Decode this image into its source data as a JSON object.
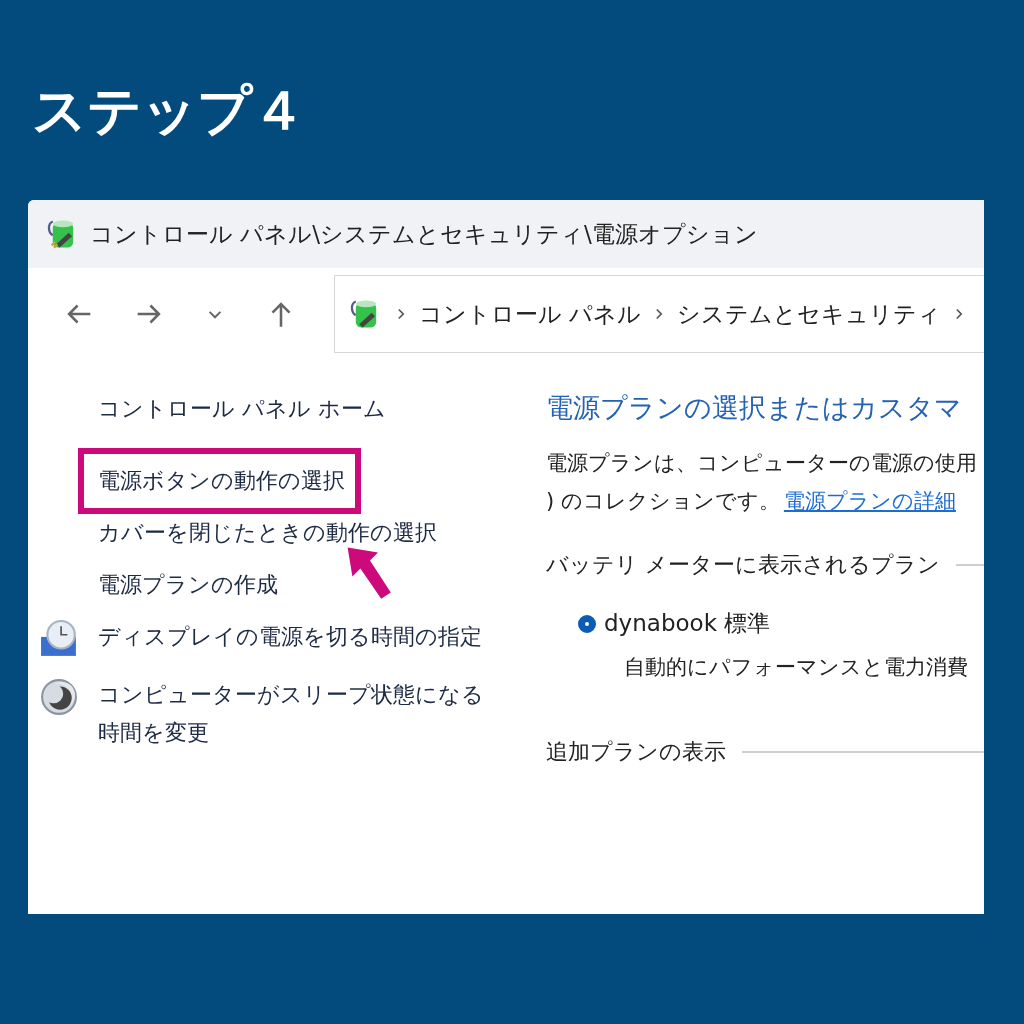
{
  "heading": "ステップ４",
  "window": {
    "title": "コントロール パネル\\システムとセキュリティ\\電源オプション"
  },
  "nav": {
    "breadcrumb": [
      "コントロール パネル",
      "システムとセキュリティ"
    ]
  },
  "sidebar": {
    "items": [
      {
        "label": "コントロール パネル ホーム",
        "kind": "plain",
        "highlighted": false
      },
      {
        "label": "電源ボタンの動作の選択",
        "kind": "plain",
        "highlighted": true
      },
      {
        "label": "カバーを閉じたときの動作の選択",
        "kind": "plain",
        "highlighted": false
      },
      {
        "label": "電源プランの作成",
        "kind": "plain",
        "highlighted": false
      },
      {
        "label": "ディスプレイの電源を切る時間の指定",
        "kind": "display",
        "highlighted": false
      },
      {
        "label": "コンピューターがスリープ状態になる時間を変更",
        "kind": "sleep",
        "highlighted": false
      }
    ]
  },
  "content": {
    "title": "電源プランの選択またはカスタマ",
    "intro_lines": [
      "電源プランは、コンピューターの電源の使用",
      ") のコレクションです。"
    ],
    "intro_link": "電源プランの詳細",
    "sections": [
      {
        "title": "バッテリ メーターに表示されるプラン",
        "plans": [
          {
            "name": "dynabook 標準",
            "selected": true,
            "description": "自動的にパフォーマンスと電力消費"
          }
        ]
      },
      {
        "title": "追加プランの表示"
      }
    ]
  }
}
